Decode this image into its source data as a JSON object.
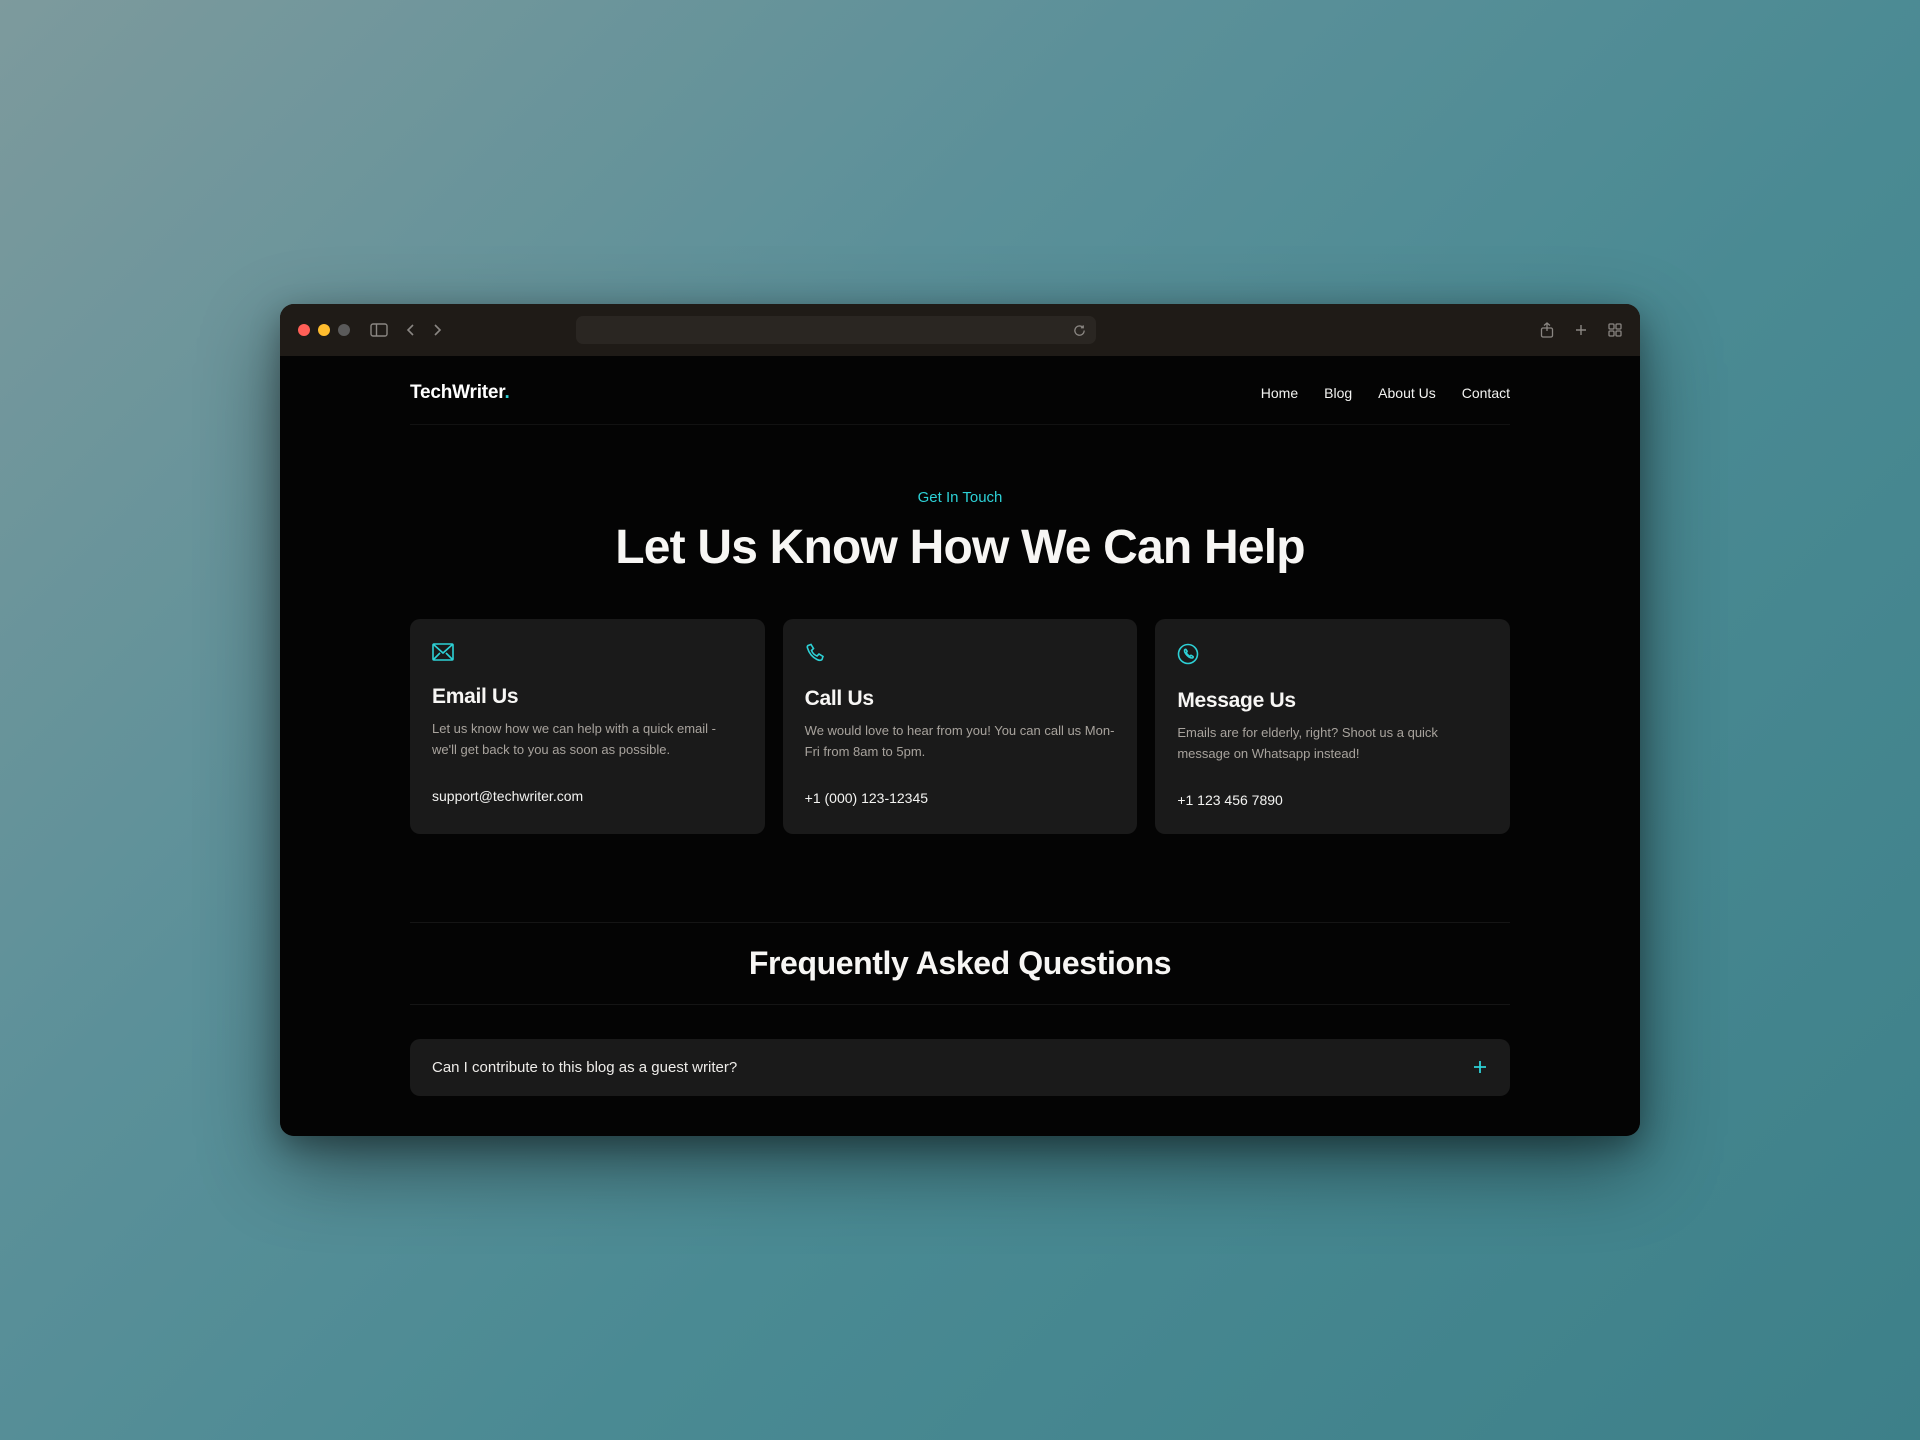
{
  "brand": {
    "name": "TechWriter",
    "dot": "."
  },
  "nav": {
    "items": [
      {
        "label": "Home"
      },
      {
        "label": "Blog"
      },
      {
        "label": "About Us"
      },
      {
        "label": "Contact"
      }
    ]
  },
  "hero": {
    "eyebrow": "Get In Touch",
    "title": "Let Us Know How We Can Help"
  },
  "cards": [
    {
      "icon": "mail-icon",
      "title": "Email Us",
      "desc": "Let us know how we can help with a quick email - we'll get back to you as soon as possible.",
      "contact": "support@techwriter.com"
    },
    {
      "icon": "phone-icon",
      "title": "Call Us",
      "desc": "We would love to hear from you! You can call us Mon-Fri from 8am to 5pm.",
      "contact": "+1 (000) 123-12345"
    },
    {
      "icon": "whatsapp-icon",
      "title": "Message Us",
      "desc": "Emails are for elderly, right? Shoot us a quick message on Whatsapp instead!",
      "contact": "+1 123 456 7890"
    }
  ],
  "faq": {
    "title": "Frequently Asked Questions",
    "items": [
      {
        "question": "Can I contribute to this blog as a guest writer?"
      }
    ]
  },
  "colors": {
    "accent": "#2dd1d6",
    "cardBg": "#1a1a1a",
    "pageBg": "#040404"
  }
}
